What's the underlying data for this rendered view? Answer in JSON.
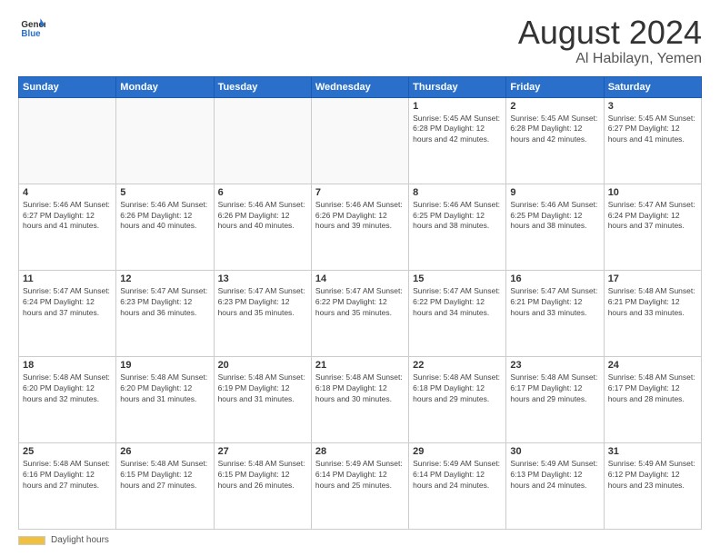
{
  "logo": {
    "line1": "General",
    "line2": "Blue"
  },
  "header": {
    "month": "August 2024",
    "location": "Al Habilayn, Yemen"
  },
  "weekdays": [
    "Sunday",
    "Monday",
    "Tuesday",
    "Wednesday",
    "Thursday",
    "Friday",
    "Saturday"
  ],
  "footer": {
    "label": "Daylight hours"
  },
  "weeks": [
    [
      {
        "day": "",
        "info": ""
      },
      {
        "day": "",
        "info": ""
      },
      {
        "day": "",
        "info": ""
      },
      {
        "day": "",
        "info": ""
      },
      {
        "day": "1",
        "info": "Sunrise: 5:45 AM\nSunset: 6:28 PM\nDaylight: 12 hours\nand 42 minutes."
      },
      {
        "day": "2",
        "info": "Sunrise: 5:45 AM\nSunset: 6:28 PM\nDaylight: 12 hours\nand 42 minutes."
      },
      {
        "day": "3",
        "info": "Sunrise: 5:45 AM\nSunset: 6:27 PM\nDaylight: 12 hours\nand 41 minutes."
      }
    ],
    [
      {
        "day": "4",
        "info": "Sunrise: 5:46 AM\nSunset: 6:27 PM\nDaylight: 12 hours\nand 41 minutes."
      },
      {
        "day": "5",
        "info": "Sunrise: 5:46 AM\nSunset: 6:26 PM\nDaylight: 12 hours\nand 40 minutes."
      },
      {
        "day": "6",
        "info": "Sunrise: 5:46 AM\nSunset: 6:26 PM\nDaylight: 12 hours\nand 40 minutes."
      },
      {
        "day": "7",
        "info": "Sunrise: 5:46 AM\nSunset: 6:26 PM\nDaylight: 12 hours\nand 39 minutes."
      },
      {
        "day": "8",
        "info": "Sunrise: 5:46 AM\nSunset: 6:25 PM\nDaylight: 12 hours\nand 38 minutes."
      },
      {
        "day": "9",
        "info": "Sunrise: 5:46 AM\nSunset: 6:25 PM\nDaylight: 12 hours\nand 38 minutes."
      },
      {
        "day": "10",
        "info": "Sunrise: 5:47 AM\nSunset: 6:24 PM\nDaylight: 12 hours\nand 37 minutes."
      }
    ],
    [
      {
        "day": "11",
        "info": "Sunrise: 5:47 AM\nSunset: 6:24 PM\nDaylight: 12 hours\nand 37 minutes."
      },
      {
        "day": "12",
        "info": "Sunrise: 5:47 AM\nSunset: 6:23 PM\nDaylight: 12 hours\nand 36 minutes."
      },
      {
        "day": "13",
        "info": "Sunrise: 5:47 AM\nSunset: 6:23 PM\nDaylight: 12 hours\nand 35 minutes."
      },
      {
        "day": "14",
        "info": "Sunrise: 5:47 AM\nSunset: 6:22 PM\nDaylight: 12 hours\nand 35 minutes."
      },
      {
        "day": "15",
        "info": "Sunrise: 5:47 AM\nSunset: 6:22 PM\nDaylight: 12 hours\nand 34 minutes."
      },
      {
        "day": "16",
        "info": "Sunrise: 5:47 AM\nSunset: 6:21 PM\nDaylight: 12 hours\nand 33 minutes."
      },
      {
        "day": "17",
        "info": "Sunrise: 5:48 AM\nSunset: 6:21 PM\nDaylight: 12 hours\nand 33 minutes."
      }
    ],
    [
      {
        "day": "18",
        "info": "Sunrise: 5:48 AM\nSunset: 6:20 PM\nDaylight: 12 hours\nand 32 minutes."
      },
      {
        "day": "19",
        "info": "Sunrise: 5:48 AM\nSunset: 6:20 PM\nDaylight: 12 hours\nand 31 minutes."
      },
      {
        "day": "20",
        "info": "Sunrise: 5:48 AM\nSunset: 6:19 PM\nDaylight: 12 hours\nand 31 minutes."
      },
      {
        "day": "21",
        "info": "Sunrise: 5:48 AM\nSunset: 6:18 PM\nDaylight: 12 hours\nand 30 minutes."
      },
      {
        "day": "22",
        "info": "Sunrise: 5:48 AM\nSunset: 6:18 PM\nDaylight: 12 hours\nand 29 minutes."
      },
      {
        "day": "23",
        "info": "Sunrise: 5:48 AM\nSunset: 6:17 PM\nDaylight: 12 hours\nand 29 minutes."
      },
      {
        "day": "24",
        "info": "Sunrise: 5:48 AM\nSunset: 6:17 PM\nDaylight: 12 hours\nand 28 minutes."
      }
    ],
    [
      {
        "day": "25",
        "info": "Sunrise: 5:48 AM\nSunset: 6:16 PM\nDaylight: 12 hours\nand 27 minutes."
      },
      {
        "day": "26",
        "info": "Sunrise: 5:48 AM\nSunset: 6:15 PM\nDaylight: 12 hours\nand 27 minutes."
      },
      {
        "day": "27",
        "info": "Sunrise: 5:48 AM\nSunset: 6:15 PM\nDaylight: 12 hours\nand 26 minutes."
      },
      {
        "day": "28",
        "info": "Sunrise: 5:49 AM\nSunset: 6:14 PM\nDaylight: 12 hours\nand 25 minutes."
      },
      {
        "day": "29",
        "info": "Sunrise: 5:49 AM\nSunset: 6:14 PM\nDaylight: 12 hours\nand 24 minutes."
      },
      {
        "day": "30",
        "info": "Sunrise: 5:49 AM\nSunset: 6:13 PM\nDaylight: 12 hours\nand 24 minutes."
      },
      {
        "day": "31",
        "info": "Sunrise: 5:49 AM\nSunset: 6:12 PM\nDaylight: 12 hours\nand 23 minutes."
      }
    ]
  ]
}
